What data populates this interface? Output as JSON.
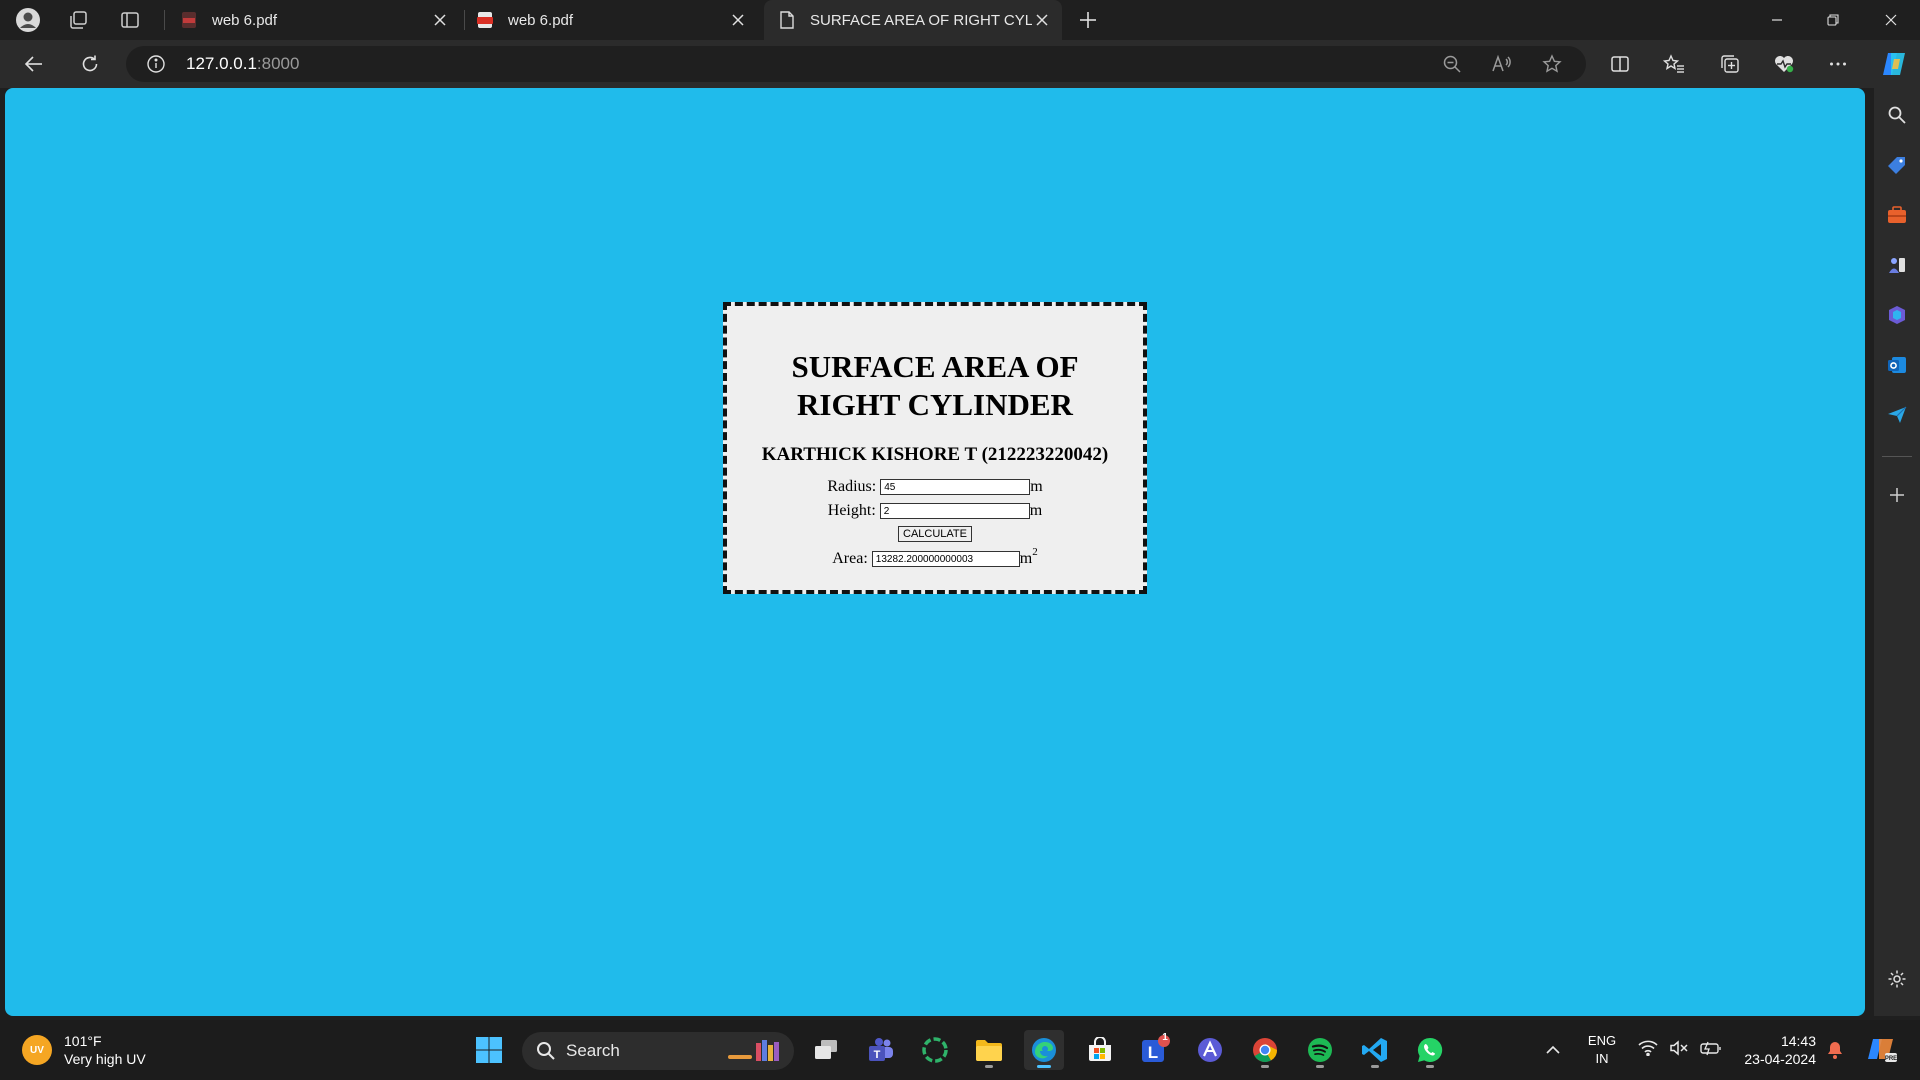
{
  "browser": {
    "tabs": [
      {
        "title": "web 6.pdf",
        "icon": "pdf-icon"
      },
      {
        "title": "web 6.pdf",
        "icon": "pdf-icon"
      },
      {
        "title": "SURFACE AREA OF RIGHT CYLINE",
        "icon": "page-icon"
      }
    ],
    "address": {
      "host": "127.0.0.1",
      "port": ":8000"
    }
  },
  "page": {
    "title": "SURFACE AREA OF RIGHT CYLINDER",
    "title_line1": "SURFACE AREA OF",
    "title_line2": "RIGHT CYLINDER",
    "author": "KARTHICK KISHORE T (212223220042)",
    "radius": {
      "label": "Radius:",
      "value": "45",
      "unit": "m"
    },
    "height": {
      "label": "Height:",
      "value": "2",
      "unit": "m"
    },
    "calculate_label": "CALCULATE",
    "area": {
      "label": "Area:",
      "value": "13282.200000000003",
      "unit": "m",
      "exponent": "2"
    },
    "background_color": "#20bbeb",
    "card_color": "#efefef"
  },
  "taskbar": {
    "weather": {
      "badge": "UV",
      "temp": "101°F",
      "desc": "Very high UV"
    },
    "search_placeholder": "Search",
    "teams_badge": "1",
    "language": {
      "line1": "ENG",
      "line2": "IN"
    },
    "clock": {
      "time": "14:43",
      "date": "23-04-2024"
    }
  }
}
